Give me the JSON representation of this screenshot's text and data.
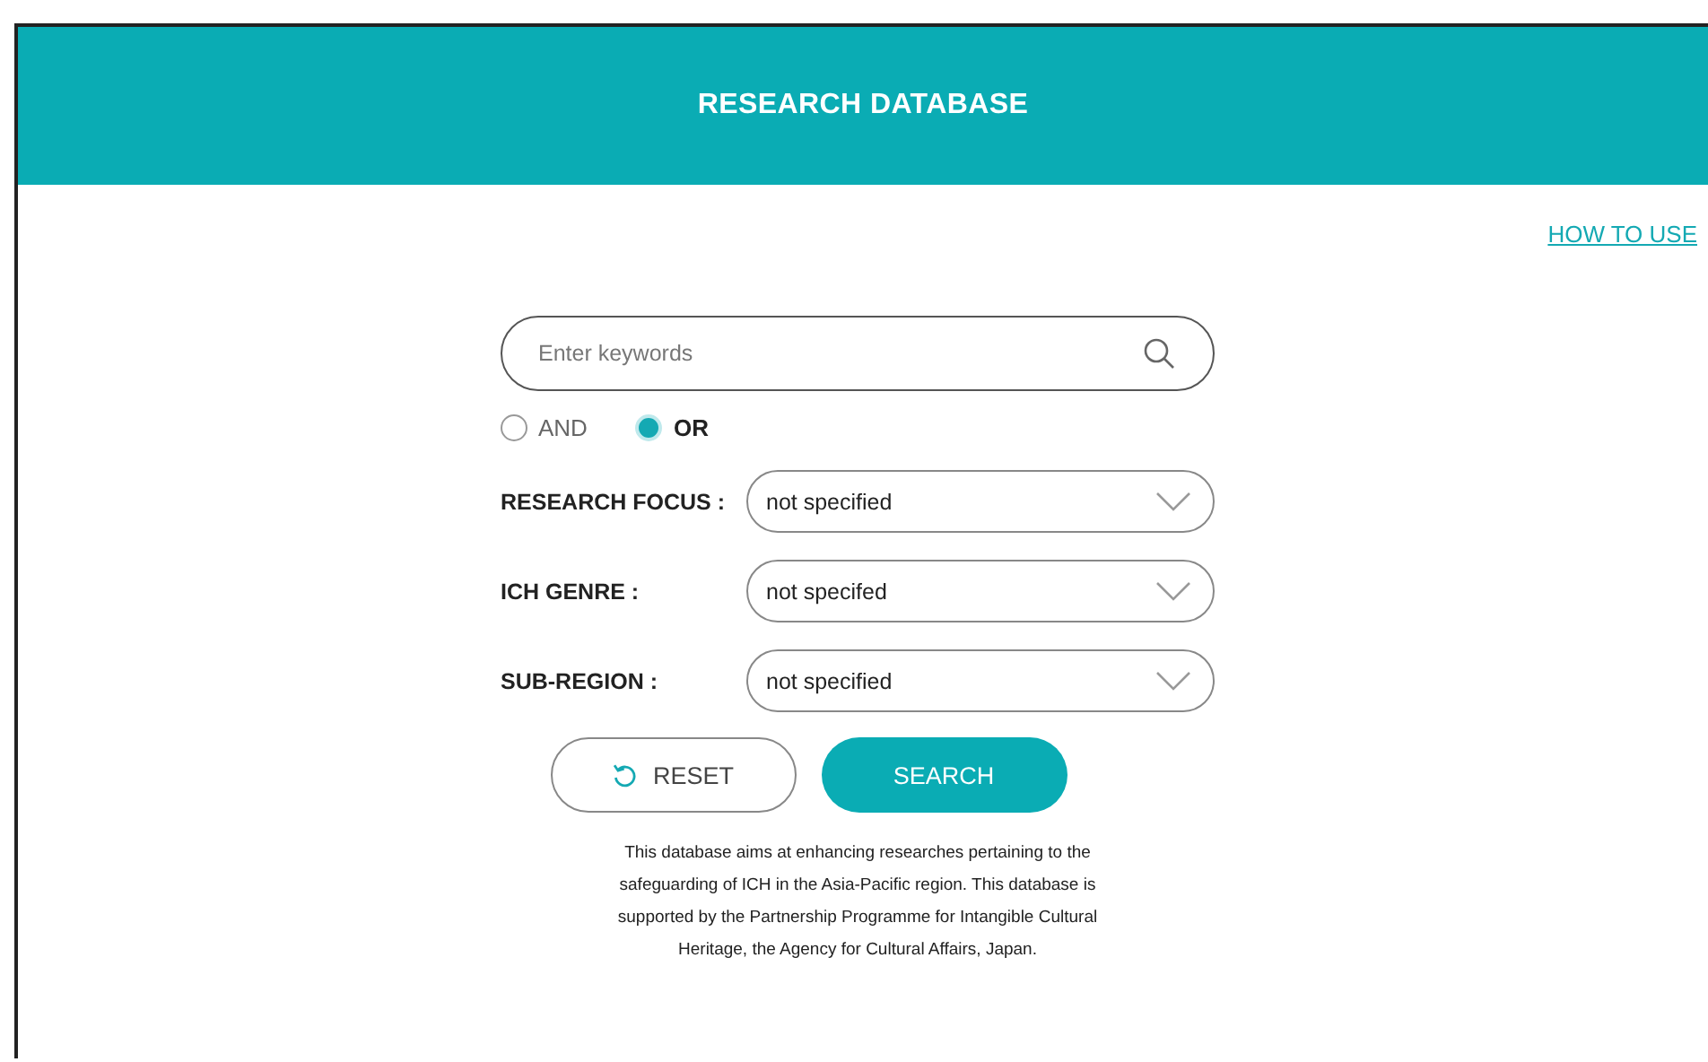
{
  "header": {
    "title": "RESEARCH DATABASE"
  },
  "help_link": "HOW TO USE",
  "search": {
    "placeholder": "Enter keywords"
  },
  "match_mode": [
    {
      "label": "AND",
      "selected": false
    },
    {
      "label": "OR",
      "selected": true
    }
  ],
  "filters": [
    {
      "label": "RESEARCH FOCUS :",
      "value": "not specified"
    },
    {
      "label": "ICH GENRE :",
      "value": "not specifed"
    },
    {
      "label": "SUB-REGION :",
      "value": "not specified"
    }
  ],
  "buttons": [
    {
      "kind": "reset",
      "label": "RESET"
    },
    {
      "kind": "search",
      "label": "SEARCH"
    }
  ],
  "description": "This database aims at enhancing researches pertaining to the safeguarding of ICH in the Asia-Pacific region. This database is supported by the Partnership Programme for Intangible Cultural Heritage, the Agency for Cultural Affairs, Japan."
}
